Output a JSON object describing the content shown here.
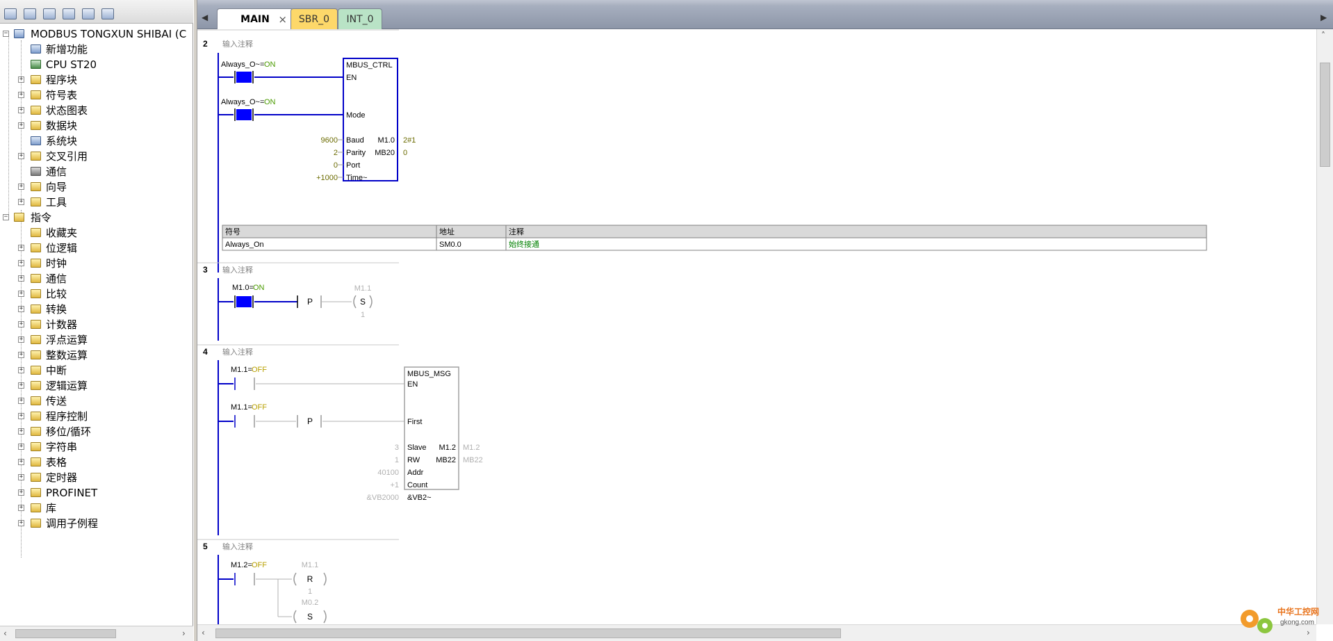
{
  "left_panel": {
    "project_label": "MODBUS TONGXUN SHIBAI (C",
    "project_items": [
      {
        "label": "新增功能",
        "icon": "help-icon"
      },
      {
        "label": "CPU ST20",
        "icon": "cpu-icon"
      },
      {
        "label": "程序块",
        "icon": "folder-icon"
      },
      {
        "label": "符号表",
        "icon": "folder-icon"
      },
      {
        "label": "状态图表",
        "icon": "folder-icon"
      },
      {
        "label": "数据块",
        "icon": "folder-icon"
      },
      {
        "label": "系统块",
        "icon": "system-block-icon"
      },
      {
        "label": "交叉引用",
        "icon": "folder-icon"
      },
      {
        "label": "通信",
        "icon": "communication-icon"
      },
      {
        "label": "向导",
        "icon": "wizard-icon"
      },
      {
        "label": "工具",
        "icon": "folder-icon"
      }
    ],
    "instructions_label": "指令",
    "instruction_items": [
      "收藏夹",
      "位逻辑",
      "时钟",
      "通信",
      "比较",
      "转换",
      "计数器",
      "浮点运算",
      "整数运算",
      "中断",
      "逻辑运算",
      "传送",
      "程序控制",
      "移位/循环",
      "字符串",
      "表格",
      "定时器",
      "PROFINET",
      "库",
      "调用子例程"
    ]
  },
  "tabs": [
    {
      "label": "MAIN",
      "close": "×"
    },
    {
      "label": "SBR_0"
    },
    {
      "label": "INT_0"
    }
  ],
  "networks": {
    "n2": {
      "number": "2",
      "comment": "输入注释",
      "contact1_label": "Always_O~=",
      "contact1_state": "ON",
      "contact2_label": "Always_O~=",
      "contact2_state": "ON",
      "block_name": "MBUS_CTRL",
      "pins": {
        "en": "EN",
        "mode": "Mode",
        "baud": "Baud",
        "parity": "Parity",
        "port": "Port",
        "timeout": "Time~"
      },
      "inputs": {
        "baud": "9600",
        "parity": "2",
        "port": "0",
        "timeout": "+1000"
      },
      "outputs": {
        "done_addr": "M1.0",
        "done_val": "2#1",
        "error_addr": "MB20",
        "error_val": "0"
      },
      "symbol_table": {
        "headers": [
          "符号",
          "地址",
          "注释"
        ],
        "row": [
          "Always_On",
          "SM0.0",
          "始终接通"
        ]
      }
    },
    "n3": {
      "number": "3",
      "comment": "输入注释",
      "contact_label": "M1.0=",
      "contact_state": "ON",
      "p_label": "P",
      "coil_addr": "M1.1",
      "coil_type": "S",
      "coil_n": "1"
    },
    "n4": {
      "number": "4",
      "comment": "输入注释",
      "contact1_label": "M1.1=",
      "contact1_state": "OFF",
      "contact2_label": "M1.1=",
      "contact2_state": "OFF",
      "p_label": "P",
      "block_name": "MBUS_MSG",
      "pins": {
        "en": "EN",
        "first": "First",
        "slave": "Slave",
        "rw": "RW",
        "addr": "Addr",
        "count": "Count",
        "ptr": "&VB2~"
      },
      "inputs": {
        "slave": "3",
        "rw": "1",
        "addr": "40100",
        "count": "+1",
        "ptr": "&VB2000"
      },
      "outputs": {
        "done_addr": "M1.2",
        "done_val": "M1.2",
        "error_addr": "MB22",
        "error_val": "MB22"
      }
    },
    "n5": {
      "number": "5",
      "comment": "输入注释",
      "contact_label": "M1.2=",
      "contact_state": "OFF",
      "coil1_addr": "M1.1",
      "coil1_type": "R",
      "coil1_n": "1",
      "coil2_addr": "M0.2",
      "coil2_type": "S"
    }
  },
  "watermark": {
    "site_cn": "中华工控网",
    "site_url": "gkong.com"
  },
  "colors": {
    "rung": "#0000c8",
    "on_state": "#4a9a00",
    "off_state": "#b8a000",
    "active_contact": "#0000ff",
    "value": "#6b6b00"
  }
}
